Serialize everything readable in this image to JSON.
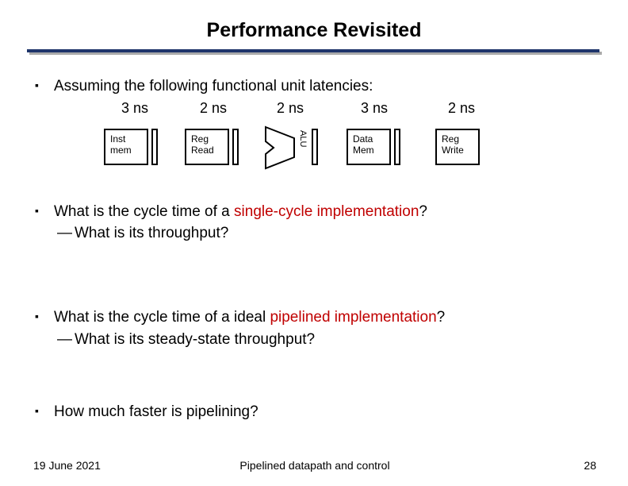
{
  "title": "Performance Revisited",
  "bullets": {
    "b1": "Assuming the following functional unit latencies:",
    "b2a": "What is the cycle time of a ",
    "b2b": "single-cycle implementation",
    "b2c": "?",
    "b2_s1": "What is its throughput?",
    "b3a": "What is the cycle time of a ideal ",
    "b3b": "pipelined implementation",
    "b3c": "?",
    "b3_s1": "What is its steady-state throughput?",
    "b4": "How much faster is pipelining?"
  },
  "diagram": {
    "lat": [
      "3 ns",
      "2 ns",
      "2 ns",
      "3 ns",
      "2 ns"
    ],
    "units": {
      "inst_mem": "Inst\nmem",
      "reg_read": "Reg\nRead",
      "alu": "ALU",
      "data_mem": "Data\nMem",
      "reg_write": "Reg\nWrite"
    }
  },
  "footer": {
    "date": "19 June 2021",
    "center": "Pipelined datapath and control",
    "page": "28"
  }
}
